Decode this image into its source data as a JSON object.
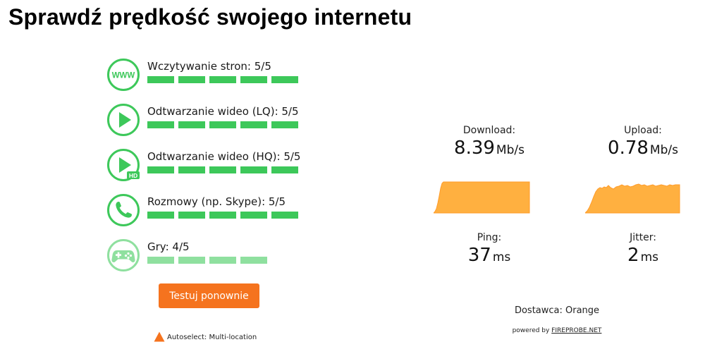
{
  "page_title": "Sprawdź prędkość swojego internetu",
  "colors": {
    "accent": "#f5731e",
    "green": "#3dc85a",
    "green_light": "#8fe09f",
    "graph_fill": "#ffb040",
    "graph_stroke": "#ff9c2a"
  },
  "features": [
    {
      "icon": "www-icon",
      "label": "Wczytywanie stron: 5/5",
      "score": 5,
      "max": 5
    },
    {
      "icon": "play-icon",
      "label": "Odtwarzanie wideo (LQ): 5/5",
      "score": 5,
      "max": 5
    },
    {
      "icon": "play-hd-icon",
      "label": "Odtwarzanie wideo (HQ): 5/5",
      "score": 5,
      "max": 5
    },
    {
      "icon": "phone-icon",
      "label": "Rozmowy (np. Skype): 5/5",
      "score": 5,
      "max": 5
    },
    {
      "icon": "gamepad-icon",
      "label": "Gry: 4/5",
      "score": 4,
      "max": 5
    }
  ],
  "retry_button": "Testuj ponownie",
  "server_select": "Autoselect: Multi-location",
  "results": {
    "download": {
      "label": "Download:",
      "value": "8.39",
      "unit": "Mb/s"
    },
    "upload": {
      "label": "Upload:",
      "value": "0.78",
      "unit": "Mb/s"
    },
    "ping": {
      "label": "Ping:",
      "value": "37",
      "unit": "ms"
    },
    "jitter": {
      "label": "Jitter:",
      "value": "2",
      "unit": "ms"
    }
  },
  "provider": "Dostawca: Orange",
  "powered_by": {
    "prefix": "powered by ",
    "link": "FIREPROBE.NET"
  }
}
